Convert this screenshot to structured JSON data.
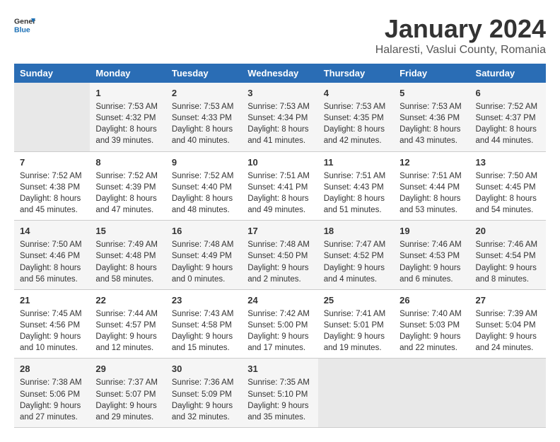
{
  "header": {
    "logo_general": "General",
    "logo_blue": "Blue",
    "title": "January 2024",
    "subtitle": "Halaresti, Vaslui County, Romania"
  },
  "days_of_week": [
    "Sunday",
    "Monday",
    "Tuesday",
    "Wednesday",
    "Thursday",
    "Friday",
    "Saturday"
  ],
  "weeks": [
    [
      {
        "day": "",
        "empty": true
      },
      {
        "day": "1",
        "sunrise": "7:53 AM",
        "sunset": "4:32 PM",
        "daylight": "8 hours and 39 minutes."
      },
      {
        "day": "2",
        "sunrise": "7:53 AM",
        "sunset": "4:33 PM",
        "daylight": "8 hours and 40 minutes."
      },
      {
        "day": "3",
        "sunrise": "7:53 AM",
        "sunset": "4:34 PM",
        "daylight": "8 hours and 41 minutes."
      },
      {
        "day": "4",
        "sunrise": "7:53 AM",
        "sunset": "4:35 PM",
        "daylight": "8 hours and 42 minutes."
      },
      {
        "day": "5",
        "sunrise": "7:53 AM",
        "sunset": "4:36 PM",
        "daylight": "8 hours and 43 minutes."
      },
      {
        "day": "6",
        "sunrise": "7:52 AM",
        "sunset": "4:37 PM",
        "daylight": "8 hours and 44 minutes."
      }
    ],
    [
      {
        "day": "7",
        "sunrise": "7:52 AM",
        "sunset": "4:38 PM",
        "daylight": "8 hours and 45 minutes."
      },
      {
        "day": "8",
        "sunrise": "7:52 AM",
        "sunset": "4:39 PM",
        "daylight": "8 hours and 47 minutes."
      },
      {
        "day": "9",
        "sunrise": "7:52 AM",
        "sunset": "4:40 PM",
        "daylight": "8 hours and 48 minutes."
      },
      {
        "day": "10",
        "sunrise": "7:51 AM",
        "sunset": "4:41 PM",
        "daylight": "8 hours and 49 minutes."
      },
      {
        "day": "11",
        "sunrise": "7:51 AM",
        "sunset": "4:43 PM",
        "daylight": "8 hours and 51 minutes."
      },
      {
        "day": "12",
        "sunrise": "7:51 AM",
        "sunset": "4:44 PM",
        "daylight": "8 hours and 53 minutes."
      },
      {
        "day": "13",
        "sunrise": "7:50 AM",
        "sunset": "4:45 PM",
        "daylight": "8 hours and 54 minutes."
      }
    ],
    [
      {
        "day": "14",
        "sunrise": "7:50 AM",
        "sunset": "4:46 PM",
        "daylight": "8 hours and 56 minutes."
      },
      {
        "day": "15",
        "sunrise": "7:49 AM",
        "sunset": "4:48 PM",
        "daylight": "8 hours and 58 minutes."
      },
      {
        "day": "16",
        "sunrise": "7:48 AM",
        "sunset": "4:49 PM",
        "daylight": "9 hours and 0 minutes."
      },
      {
        "day": "17",
        "sunrise": "7:48 AM",
        "sunset": "4:50 PM",
        "daylight": "9 hours and 2 minutes."
      },
      {
        "day": "18",
        "sunrise": "7:47 AM",
        "sunset": "4:52 PM",
        "daylight": "9 hours and 4 minutes."
      },
      {
        "day": "19",
        "sunrise": "7:46 AM",
        "sunset": "4:53 PM",
        "daylight": "9 hours and 6 minutes."
      },
      {
        "day": "20",
        "sunrise": "7:46 AM",
        "sunset": "4:54 PM",
        "daylight": "9 hours and 8 minutes."
      }
    ],
    [
      {
        "day": "21",
        "sunrise": "7:45 AM",
        "sunset": "4:56 PM",
        "daylight": "9 hours and 10 minutes."
      },
      {
        "day": "22",
        "sunrise": "7:44 AM",
        "sunset": "4:57 PM",
        "daylight": "9 hours and 12 minutes."
      },
      {
        "day": "23",
        "sunrise": "7:43 AM",
        "sunset": "4:58 PM",
        "daylight": "9 hours and 15 minutes."
      },
      {
        "day": "24",
        "sunrise": "7:42 AM",
        "sunset": "5:00 PM",
        "daylight": "9 hours and 17 minutes."
      },
      {
        "day": "25",
        "sunrise": "7:41 AM",
        "sunset": "5:01 PM",
        "daylight": "9 hours and 19 minutes."
      },
      {
        "day": "26",
        "sunrise": "7:40 AM",
        "sunset": "5:03 PM",
        "daylight": "9 hours and 22 minutes."
      },
      {
        "day": "27",
        "sunrise": "7:39 AM",
        "sunset": "5:04 PM",
        "daylight": "9 hours and 24 minutes."
      }
    ],
    [
      {
        "day": "28",
        "sunrise": "7:38 AM",
        "sunset": "5:06 PM",
        "daylight": "9 hours and 27 minutes."
      },
      {
        "day": "29",
        "sunrise": "7:37 AM",
        "sunset": "5:07 PM",
        "daylight": "9 hours and 29 minutes."
      },
      {
        "day": "30",
        "sunrise": "7:36 AM",
        "sunset": "5:09 PM",
        "daylight": "9 hours and 32 minutes."
      },
      {
        "day": "31",
        "sunrise": "7:35 AM",
        "sunset": "5:10 PM",
        "daylight": "9 hours and 35 minutes."
      },
      {
        "day": "",
        "empty": true
      },
      {
        "day": "",
        "empty": true
      },
      {
        "day": "",
        "empty": true
      }
    ]
  ],
  "labels": {
    "sunrise": "Sunrise:",
    "sunset": "Sunset:",
    "daylight": "Daylight:"
  }
}
